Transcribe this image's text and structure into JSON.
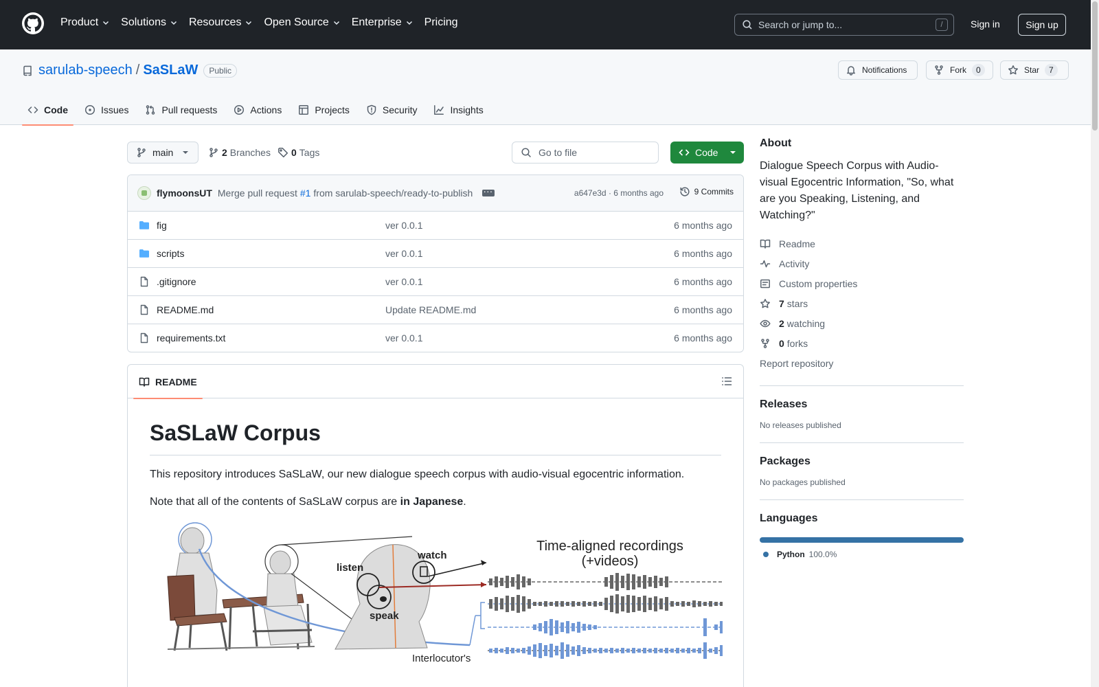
{
  "header": {
    "nav": [
      "Product",
      "Solutions",
      "Resources",
      "Open Source",
      "Enterprise",
      "Pricing"
    ],
    "search_placeholder": "Search or jump to...",
    "search_shortcut": "/",
    "sign_in": "Sign in",
    "sign_up": "Sign up"
  },
  "repo": {
    "owner": "sarulab-speech",
    "separator": "/",
    "name": "SaSLaW",
    "visibility": "Public",
    "notifications": "Notifications",
    "fork_label": "Fork",
    "fork_count": "0",
    "star_label": "Star",
    "star_count": "7",
    "tabs": [
      {
        "label": "Code",
        "icon": "code-icon"
      },
      {
        "label": "Issues",
        "icon": "issue-icon"
      },
      {
        "label": "Pull requests",
        "icon": "pull-request-icon"
      },
      {
        "label": "Actions",
        "icon": "play-icon"
      },
      {
        "label": "Projects",
        "icon": "table-icon"
      },
      {
        "label": "Security",
        "icon": "shield-icon"
      },
      {
        "label": "Insights",
        "icon": "graph-icon"
      }
    ]
  },
  "files": {
    "branch": "main",
    "branches_count": "2",
    "branches_label": "Branches",
    "tags_count": "0",
    "tags_label": "Tags",
    "goto_placeholder": "Go to file",
    "code_button": "Code",
    "commit": {
      "author": "flymoonsUT",
      "message_pre": "Merge pull request",
      "pr_number": "#1",
      "message_post": "from sarulab-speech/ready-to-publish",
      "meta": "a647e3d · 6 months ago",
      "count": "9 Commits"
    },
    "rows": [
      {
        "name": "fig",
        "type": "folder",
        "message": "ver 0.0.1",
        "age": "6 months ago"
      },
      {
        "name": "scripts",
        "type": "folder",
        "message": "ver 0.0.1",
        "age": "6 months ago"
      },
      {
        "name": ".gitignore",
        "type": "file",
        "message": "ver 0.0.1",
        "age": "6 months ago"
      },
      {
        "name": "README.md",
        "type": "file",
        "message": "Update README.md",
        "age": "6 months ago"
      },
      {
        "name": "requirements.txt",
        "type": "file",
        "message": "ver 0.0.1",
        "age": "6 months ago"
      }
    ]
  },
  "readme": {
    "tab": "README",
    "title": "SaSLaW Corpus",
    "p1": "This repository introduces SaSLaW, our new dialogue speech corpus with audio-visual egocentric information.",
    "p2_pre": "Note that all of the contents of SaSLaW corpus are ",
    "p2_bold": "in Japanese",
    "p2_post": ".",
    "figure": {
      "title_line1": "Time-aligned recordings",
      "title_line2": "(+videos)",
      "label_listen": "listen",
      "label_watch": "watch",
      "label_speak": "speak",
      "label_interlocutor": "Interlocutor's"
    }
  },
  "sidebar": {
    "about_title": "About",
    "description": "Dialogue Speech Corpus with Audio-visual Egocentric Information, \"So, what are you Speaking, Listening, and Watching?\"",
    "links": [
      {
        "icon": "book-icon",
        "bold": "",
        "label": "Readme"
      },
      {
        "icon": "pulse-icon",
        "bold": "",
        "label": "Activity"
      },
      {
        "icon": "note-icon",
        "bold": "",
        "label": "Custom properties"
      },
      {
        "icon": "star-icon",
        "bold": "7",
        "label": "stars"
      },
      {
        "icon": "eye-icon",
        "bold": "2",
        "label": "watching"
      },
      {
        "icon": "fork-icon",
        "bold": "0",
        "label": "forks"
      }
    ],
    "report": "Report repository",
    "releases_title": "Releases",
    "releases_text": "No releases published",
    "packages_title": "Packages",
    "packages_text": "No packages published",
    "languages_title": "Languages",
    "language": "Python",
    "language_pct": "100.0%",
    "language_color": "#3572A5"
  }
}
